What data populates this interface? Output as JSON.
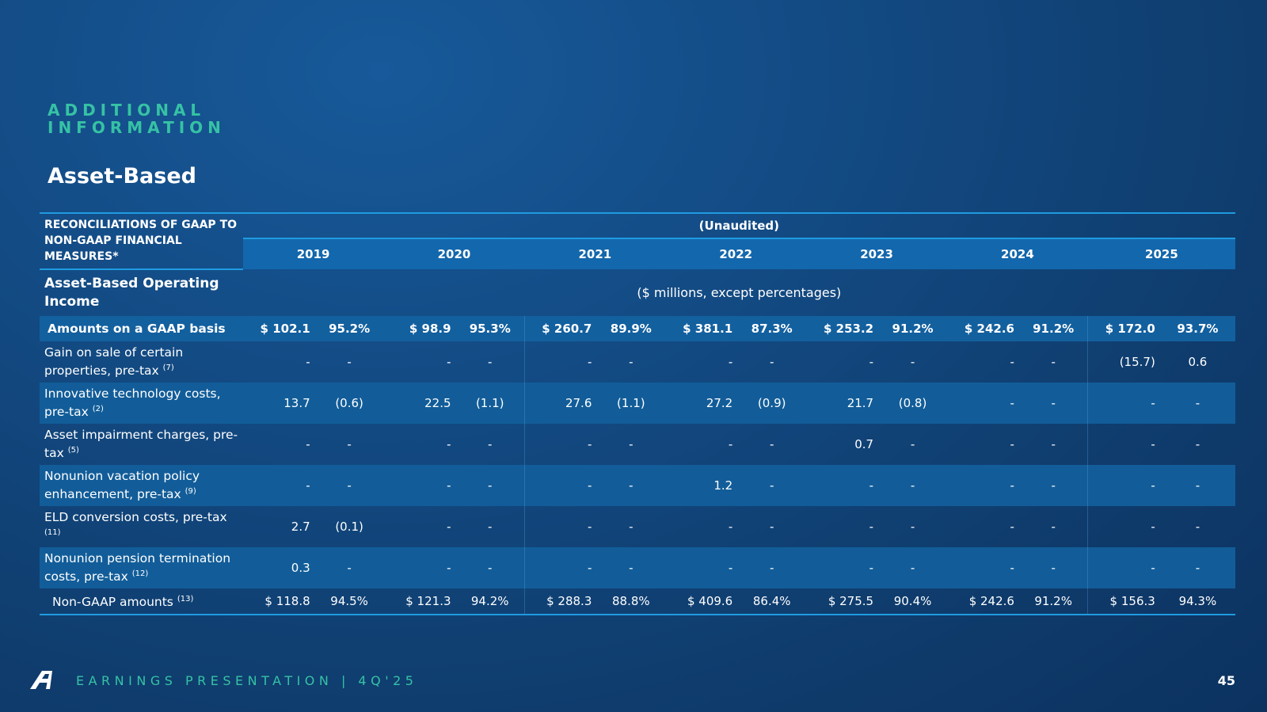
{
  "section": {
    "line1": "ADDITIONAL",
    "line2": "INFORMATION"
  },
  "title": "Asset-Based",
  "table": {
    "header_label": "RECONCILIATIONS OF GAAP TO NON-GAAP FINANCIAL MEASURES*",
    "unaudited": "(Unaudited)",
    "years": [
      "2019",
      "2020",
      "2021",
      "2022",
      "2023",
      "2024",
      "2025"
    ],
    "subhead": "Asset-Based Operating Income",
    "units": "($ millions, except percentages)",
    "gaap_row": {
      "label": "Amounts on a GAAP basis",
      "cells": [
        "$ 102.1",
        "95.2%",
        "$   98.9",
        "95.3%",
        "$ 260.7",
        "89.9%",
        "$  381.1",
        "87.3%",
        "$ 253.2",
        "91.2%",
        "$ 242.6",
        "91.2%",
        "$ 172.0",
        "93.7%"
      ]
    },
    "rows": [
      {
        "label": "Gain on sale of certain properties, pre-tax",
        "note": "(7)",
        "cells": [
          "-",
          "-",
          "-",
          "-",
          "-",
          "-",
          "-",
          "-",
          "-",
          "-",
          "-",
          "-",
          "(15.7)",
          "0.6"
        ]
      },
      {
        "label": "Innovative technology costs, pre-tax",
        "note": "(2)",
        "cells": [
          "13.7",
          "(0.6)",
          "22.5",
          "(1.1)",
          "27.6",
          "(1.1)",
          "27.2",
          "(0.9)",
          "21.7",
          "(0.8)",
          "-",
          "-",
          "-",
          "-"
        ]
      },
      {
        "label": "Asset impairment charges, pre-tax",
        "note": "(5)",
        "cells": [
          "-",
          "-",
          "-",
          "-",
          "-",
          "-",
          "-",
          "-",
          "0.7",
          "-",
          "-",
          "-",
          "-",
          "-"
        ]
      },
      {
        "label": "Nonunion vacation policy enhancement, pre-tax",
        "note": "(9)",
        "cells": [
          "-",
          "-",
          "-",
          "-",
          "-",
          "-",
          "1.2",
          "-",
          "-",
          "-",
          "-",
          "-",
          "-",
          "-"
        ]
      },
      {
        "label": "ELD conversion costs, pre-tax",
        "note": "(11)",
        "cells": [
          "2.7",
          "(0.1)",
          "-",
          "-",
          "-",
          "-",
          "-",
          "-",
          "-",
          "-",
          "-",
          "-",
          "-",
          "-"
        ]
      },
      {
        "label": "Nonunion pension termination costs, pre-tax",
        "note": "(12)",
        "cells": [
          "0.3",
          "-",
          "-",
          "-",
          "-",
          "-",
          "-",
          "-",
          "-",
          "-",
          "-",
          "-",
          "-",
          "-"
        ]
      }
    ],
    "nongaap_row": {
      "label": "Non-GAAP amounts",
      "note": "(13)",
      "cells": [
        "$ 118.8",
        "94.5%",
        "$   121.3",
        "94.2%",
        "$ 288.3",
        "88.8%",
        "$ 409.6",
        "86.4%",
        "$ 275.5",
        "90.4%",
        "$ 242.6",
        "91.2%",
        "$  156.3",
        "94.3%"
      ]
    }
  },
  "footer": {
    "text": "EARNINGS PRESENTATION  |  4Q'25",
    "page": "45",
    "logo": "company-logo-icon"
  },
  "colors": {
    "accent": "#36c2a4",
    "rule": "#1f9be0",
    "band": "#125d99"
  }
}
